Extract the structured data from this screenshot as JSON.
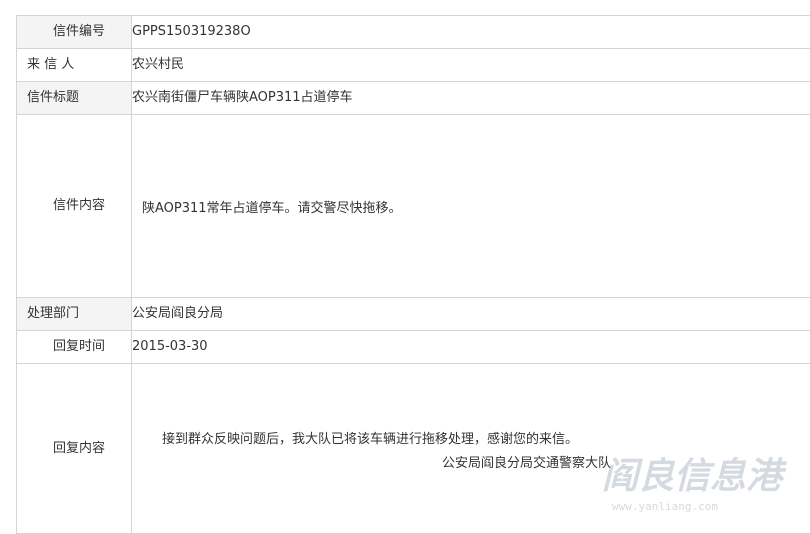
{
  "letter": {
    "rows": [
      {
        "label": "信件编号",
        "value": "GPPS150319238O"
      },
      {
        "label": "来 信 人",
        "value": "农兴村民"
      },
      {
        "label": "信件标题",
        "value": "农兴南街僵尸车辆陕AOP311占道停车"
      },
      {
        "label": "信件内容",
        "value": "陕AOP311常年占道停车。请交警尽快拖移。"
      },
      {
        "label": "处理部门",
        "value": "公安局阎良分局"
      },
      {
        "label": "回复时间",
        "value": "2015-03-30"
      },
      {
        "label": "回复内容",
        "value": "接到群众反映问题后，我大队已将该车辆进行拖移处理，感谢您的来信。",
        "signature": "公安局阎良分局交通警察大队"
      }
    ]
  },
  "watermark": {
    "title": "阎良信息港",
    "url": "www.yanliang.com"
  },
  "colors": {
    "border": "#d4d4d4",
    "label_bg": "#f4f4f4",
    "text": "#333333"
  }
}
